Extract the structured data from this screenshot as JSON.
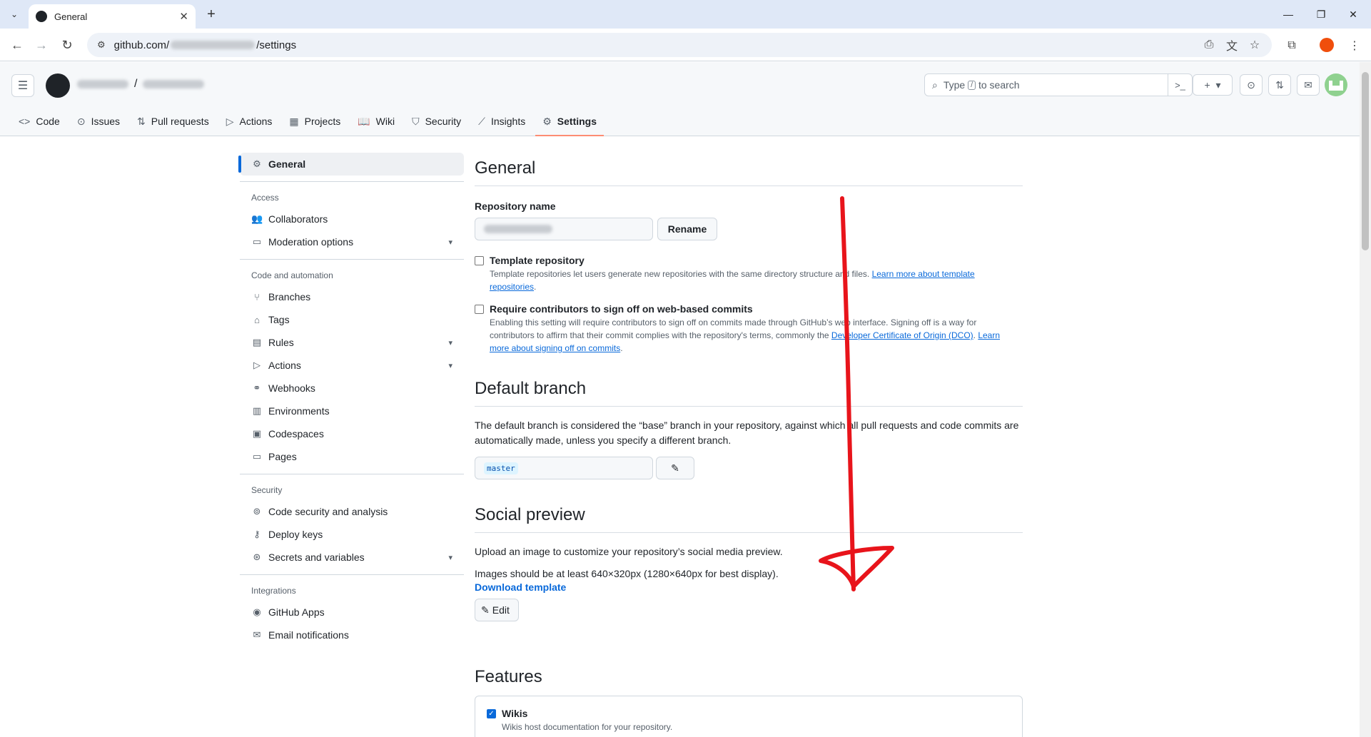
{
  "browser": {
    "tab_title": "General",
    "url_prefix": "github.com/",
    "url_suffix": "/settings"
  },
  "header": {
    "search_text_before": "Type",
    "search_key": "/",
    "search_text_after": "to search",
    "crumb_separator": "/"
  },
  "repo_nav": [
    {
      "label": "Code",
      "icon": "code-icon"
    },
    {
      "label": "Issues",
      "icon": "issue-icon"
    },
    {
      "label": "Pull requests",
      "icon": "pull-request-icon"
    },
    {
      "label": "Actions",
      "icon": "play-icon"
    },
    {
      "label": "Projects",
      "icon": "table-icon"
    },
    {
      "label": "Wiki",
      "icon": "book-icon"
    },
    {
      "label": "Security",
      "icon": "shield-icon"
    },
    {
      "label": "Insights",
      "icon": "graph-icon"
    },
    {
      "label": "Settings",
      "icon": "gear-icon",
      "active": true
    }
  ],
  "sidebar": {
    "general": "General",
    "groups": {
      "access": "Access",
      "code_automation": "Code and automation",
      "security": "Security",
      "integrations": "Integrations"
    },
    "items": {
      "collaborators": "Collaborators",
      "moderation": "Moderation options",
      "branches": "Branches",
      "tags": "Tags",
      "rules": "Rules",
      "actions": "Actions",
      "webhooks": "Webhooks",
      "environments": "Environments",
      "codespaces": "Codespaces",
      "pages": "Pages",
      "code_security": "Code security and analysis",
      "deploy_keys": "Deploy keys",
      "secrets": "Secrets and variables",
      "github_apps": "GitHub Apps",
      "email_notifications": "Email notifications"
    }
  },
  "general": {
    "title": "General",
    "repo_name_label": "Repository name",
    "rename_button": "Rename",
    "template_repo": {
      "label": "Template repository",
      "desc": "Template repositories let users generate new repositories with the same directory structure and files.",
      "link": "Learn more about template repositories",
      "checked": false
    },
    "signoff": {
      "label": "Require contributors to sign off on web-based commits",
      "desc_1": "Enabling this setting will require contributors to sign off on commits made through GitHub’s web interface. Signing off is a way for contributors to affirm that their commit complies with the repository's terms, commonly the",
      "link_dco": "Developer Certificate of Origin (DCO)",
      "link_learn": "Learn more about signing off on commits",
      "checked": false
    }
  },
  "default_branch": {
    "title": "Default branch",
    "desc": "The default branch is considered the “base” branch in your repository, against which all pull requests and code commits are automatically made, unless you specify a different branch.",
    "branch": "master"
  },
  "social_preview": {
    "title": "Social preview",
    "desc": "Upload an image to customize your repository’s social media preview.",
    "size_note": "Images should be at least 640×320px (1280×640px for best display).",
    "download_link": "Download template",
    "edit_button": "Edit"
  },
  "features": {
    "title": "Features",
    "wikis_label": "Wikis",
    "wikis_desc": "Wikis host documentation for your repository.",
    "wikis_checked": true
  },
  "colors": {
    "accent": "#0969da",
    "active_tab_underline": "#fd8c73",
    "annotation_red": "#e8141b"
  }
}
